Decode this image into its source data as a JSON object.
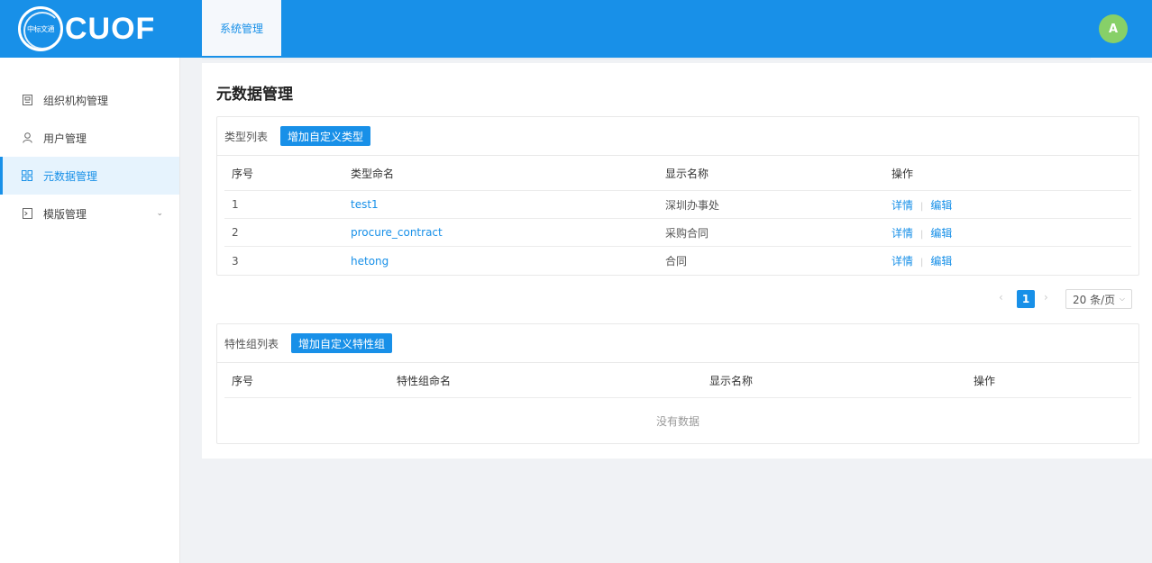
{
  "header": {
    "logo_mark_text": "中标文通",
    "logo_text": "CUOF",
    "top_tab": "系统管理",
    "avatar_letter": "A"
  },
  "sidebar": {
    "items": [
      {
        "label": "组织机构管理",
        "icon": "org-icon"
      },
      {
        "label": "用户管理",
        "icon": "user-icon"
      },
      {
        "label": "元数据管理",
        "icon": "grid-icon"
      },
      {
        "label": "模版管理",
        "icon": "template-icon"
      }
    ],
    "active_index": 2
  },
  "main": {
    "title": "元数据管理",
    "type_list": {
      "title": "类型列表",
      "add_button": "增加自定义类型",
      "columns": [
        "序号",
        "类型命名",
        "显示名称",
        "操作"
      ],
      "rows": [
        {
          "no": "1",
          "name": "test1",
          "display": "深圳办事处",
          "detail": "详情",
          "edit": "编辑"
        },
        {
          "no": "2",
          "name": "procure_contract",
          "display": "采购合同",
          "detail": "详情",
          "edit": "编辑"
        },
        {
          "no": "3",
          "name": "hetong",
          "display": "合同",
          "detail": "详情",
          "edit": "编辑"
        }
      ]
    },
    "pagination": {
      "current_page": "1",
      "page_size": "20 条/页"
    },
    "feature_group_list": {
      "title": "特性组列表",
      "add_button": "增加自定义特性组",
      "columns": [
        "序号",
        "特性组命名",
        "显示名称",
        "操作"
      ],
      "empty_text": "没有数据"
    }
  },
  "colors": {
    "primary": "#1890e8",
    "avatar": "#87d068"
  }
}
